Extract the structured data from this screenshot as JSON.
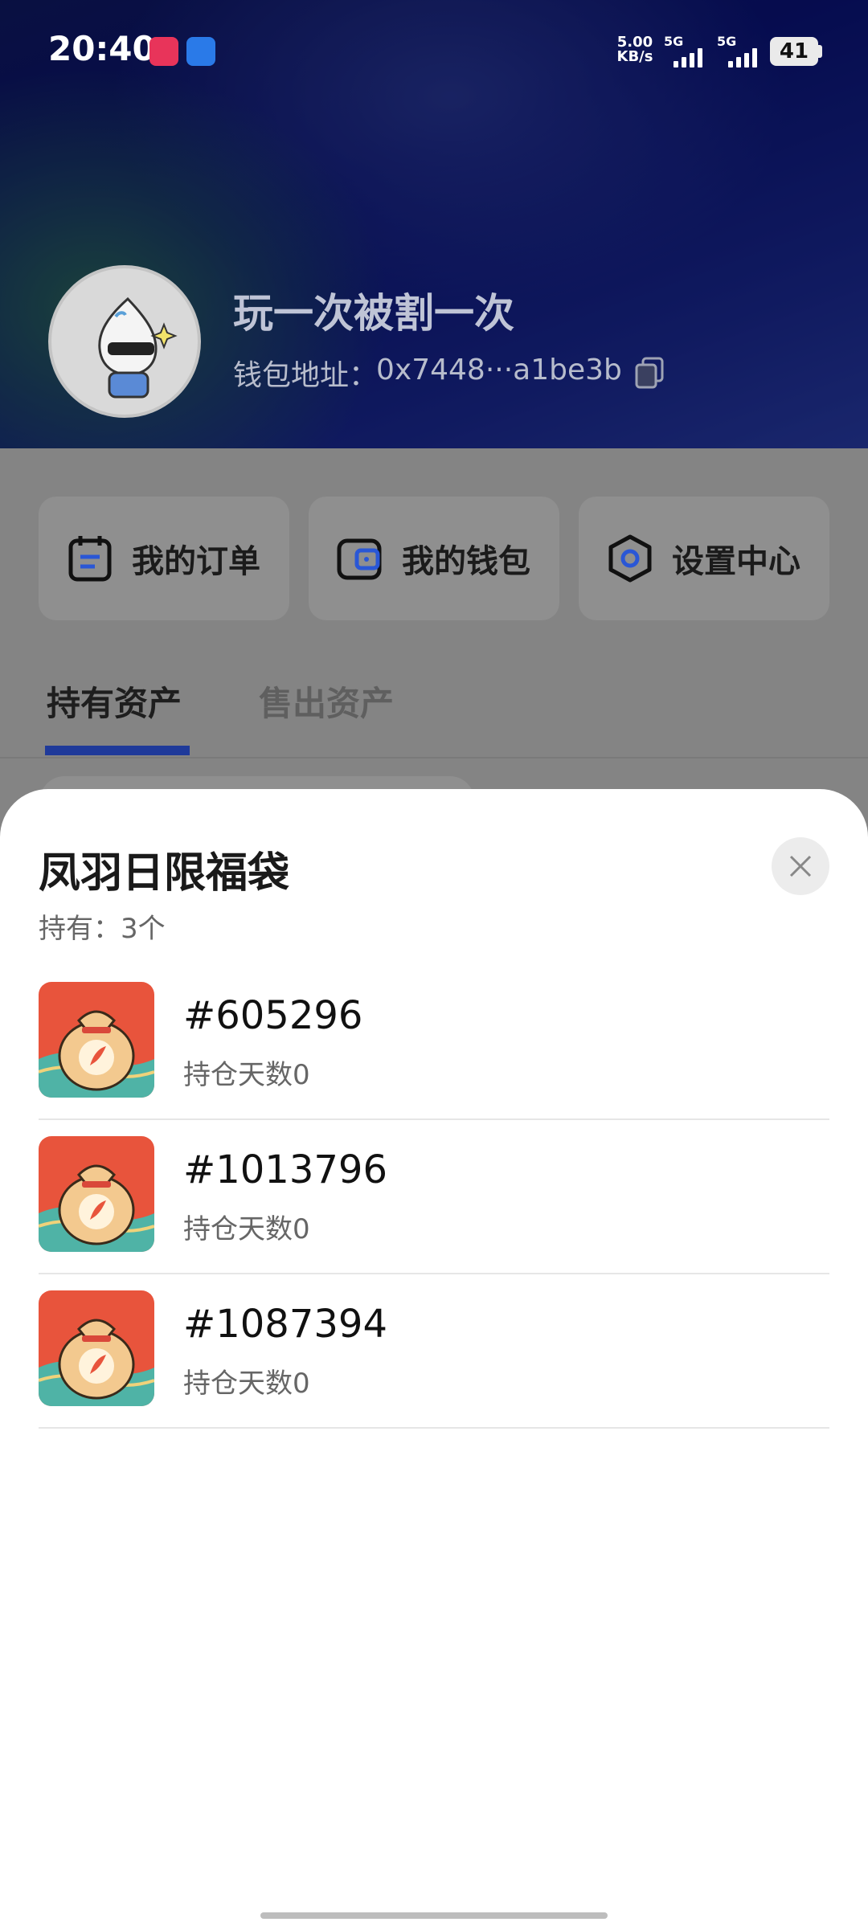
{
  "status_bar": {
    "time": "20:40",
    "net_speed_value": "5.00",
    "net_speed_unit": "KB/s",
    "sim1": "5G",
    "sim2": "5G",
    "battery": "41"
  },
  "profile": {
    "username": "玩一次被割一次",
    "wallet_label": "钱包地址：",
    "wallet_address": "0x7448···a1be3b"
  },
  "quick_actions": [
    {
      "label": "我的订单",
      "icon": "order-icon"
    },
    {
      "label": "我的钱包",
      "icon": "wallet-icon"
    },
    {
      "label": "设置中心",
      "icon": "settings-icon"
    }
  ],
  "tabs": [
    {
      "label": "持有资产",
      "active": true
    },
    {
      "label": "售出资产",
      "active": false
    }
  ],
  "sheet": {
    "title": "凤羽日限福袋",
    "subtitle": "持有：3个",
    "items": [
      {
        "id": "#605296",
        "days": "持仓天数0"
      },
      {
        "id": "#1013796",
        "days": "持仓天数0"
      },
      {
        "id": "#1087394",
        "days": "持仓天数0"
      }
    ]
  },
  "colors": {
    "accent": "#1f3a9a",
    "icon_blue": "#2a57d6",
    "header_blue": "#0a1480"
  }
}
